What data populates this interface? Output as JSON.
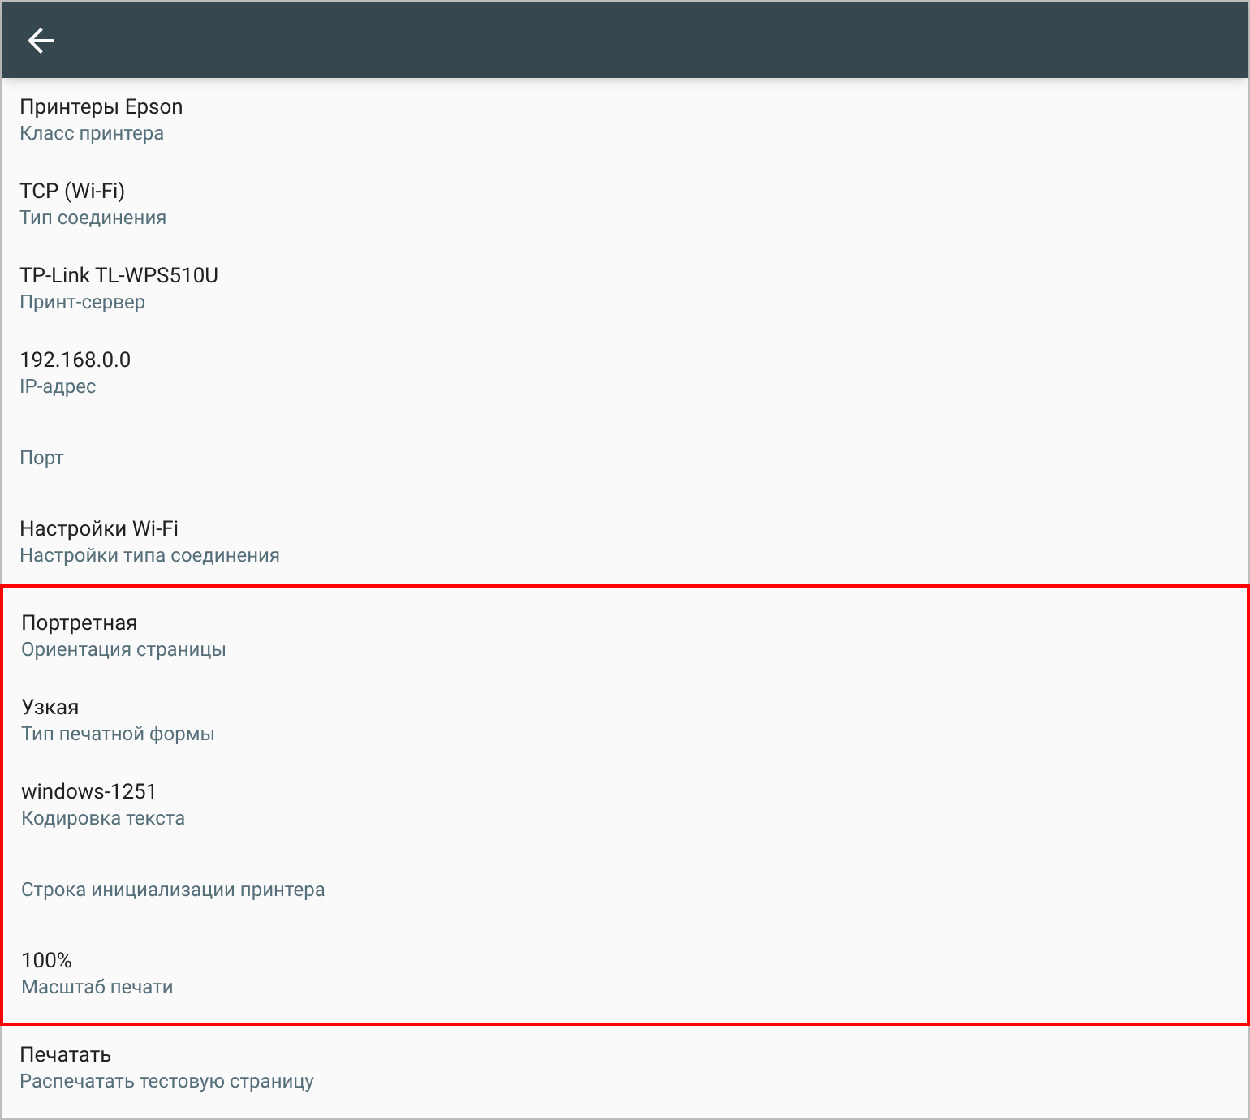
{
  "sections": [
    {
      "highlighted": false,
      "items": [
        {
          "value": "Принтеры Epson",
          "label": "Класс принтера"
        },
        {
          "value": "TCP (Wi-Fi)",
          "label": "Тип соединения"
        },
        {
          "value": "TP-Link TL-WPS510U",
          "label": "Принт-сервер"
        },
        {
          "value": "192.168.0.0",
          "label": "IP-адрес"
        },
        {
          "label": "Порт"
        },
        {
          "value": "Настройки Wi-Fi",
          "label": "Настройки типа соединения"
        }
      ]
    },
    {
      "highlighted": true,
      "items": [
        {
          "value": "Портретная",
          "label": "Ориентация страницы"
        },
        {
          "value": "Узкая",
          "label": "Тип печатной формы"
        },
        {
          "value": "windows-1251",
          "label": "Кодировка текста"
        },
        {
          "label": "Строка инициализации принтера"
        },
        {
          "value": "100%",
          "label": "Масштаб печати"
        }
      ]
    },
    {
      "highlighted": false,
      "items": [
        {
          "value": "Печатать",
          "label": "Распечатать тестовую страницу"
        }
      ]
    }
  ]
}
